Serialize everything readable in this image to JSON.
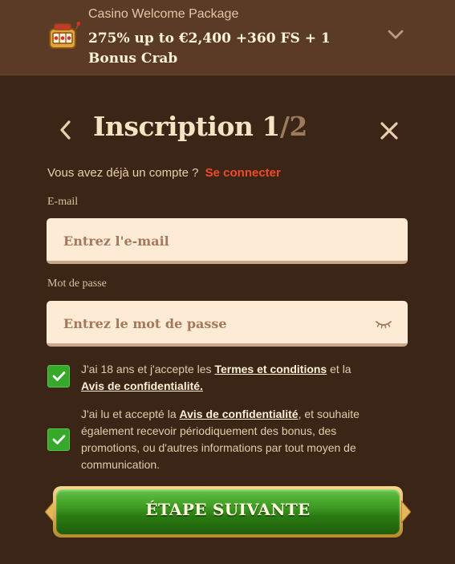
{
  "promo": {
    "subtitle": "Casino Welcome Package",
    "headline": "275% up to €2,400 +360 FS + 1 Bonus Crab"
  },
  "header": {
    "title": "Inscription",
    "step_current": "1",
    "step_total": "/2"
  },
  "account": {
    "prompt": "Vous avez déjà un compte ?",
    "login_link": "Se connecter"
  },
  "email": {
    "label": "E-mail",
    "placeholder": "Entrez l'e-mail"
  },
  "password": {
    "label": "Mot de passe",
    "placeholder": "Entrez le mot de passe"
  },
  "consent_terms": {
    "checked": true,
    "text_before": "J'ai 18 ans et j'accepte les ",
    "link1": "Termes et conditions",
    "text_middle": " et la",
    "link2": "Avis de confidentialité."
  },
  "consent_marketing": {
    "checked": true,
    "text_before": "J'ai lu et accepté la ",
    "link": "Avis de confidentialité",
    "text_after": ", et souhaite également recevoir périodiquement des bonus, des promotions, ou d'autres informations par tout moyen de communication."
  },
  "cta": {
    "label": "ÉTAPE SUIVANTE"
  },
  "colors": {
    "background": "#3a2516",
    "promo_bar": "#5b3b25",
    "login_link": "#f2492a",
    "checkbox": "#36a92a",
    "cta_green": "#3d9a22",
    "cta_gold": "#f5d98a"
  },
  "icons": {
    "promo": "slot-machine-icon",
    "expand": "chevron-down-icon",
    "back": "chevron-left-icon",
    "close": "close-icon",
    "password_toggle": "eye-closed-icon",
    "check": "checkmark-icon"
  }
}
